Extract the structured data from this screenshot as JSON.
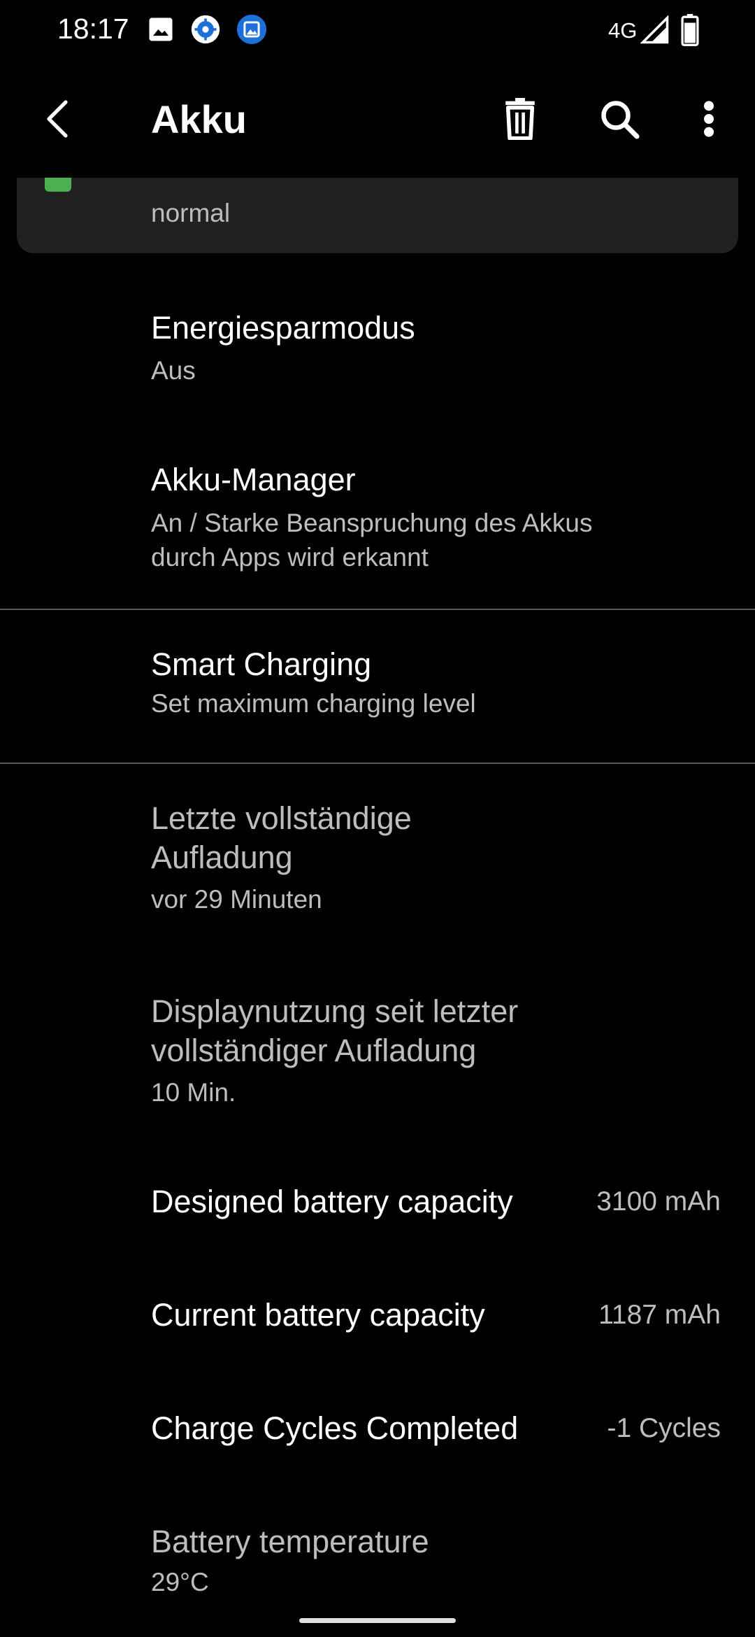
{
  "status_bar": {
    "time": "18:17",
    "network": "4G",
    "icons": [
      "image-icon",
      "gear-notification-icon",
      "gallery-notification-icon",
      "signal-icon",
      "battery-icon"
    ]
  },
  "app_bar": {
    "title": "Akku",
    "icons": [
      "back-arrow-icon",
      "trash-icon",
      "search-icon",
      "more-vert-icon"
    ]
  },
  "tip_card": {
    "text": "normal",
    "accent_color": "#4caf50"
  },
  "items": {
    "power_saving": {
      "title": "Energiesparmodus",
      "subtitle": "Aus"
    },
    "battery_manager": {
      "title": "Akku-Manager",
      "subtitle_line1": "An / Starke Beanspruchung des Akkus",
      "subtitle_line2": "durch Apps wird erkannt"
    },
    "smart_charging": {
      "title": "Smart Charging",
      "subtitle": "Set maximum charging level"
    },
    "last_full_charge": {
      "title_line1": "Letzte vollständige",
      "title_line2": "Aufladung",
      "subtitle": "vor 29 Minuten"
    },
    "screen_usage": {
      "title_line1": "Displaynutzung seit letzter",
      "title_line2": "vollständiger Aufladung",
      "subtitle": "10 Min."
    },
    "designed_capacity": {
      "title": "Designed battery capacity",
      "value": "3100 mAh"
    },
    "current_capacity": {
      "title": "Current battery capacity",
      "value": "1187 mAh"
    },
    "charge_cycles": {
      "title": "Charge Cycles Completed",
      "value": "-1 Cycles"
    },
    "battery_temperature": {
      "title": "Battery temperature",
      "subtitle": "29°C"
    }
  },
  "colors": {
    "background": "#000000",
    "card": "#212121",
    "secondary_text": "#bdbdbd",
    "divider": "#5a5a5a"
  }
}
